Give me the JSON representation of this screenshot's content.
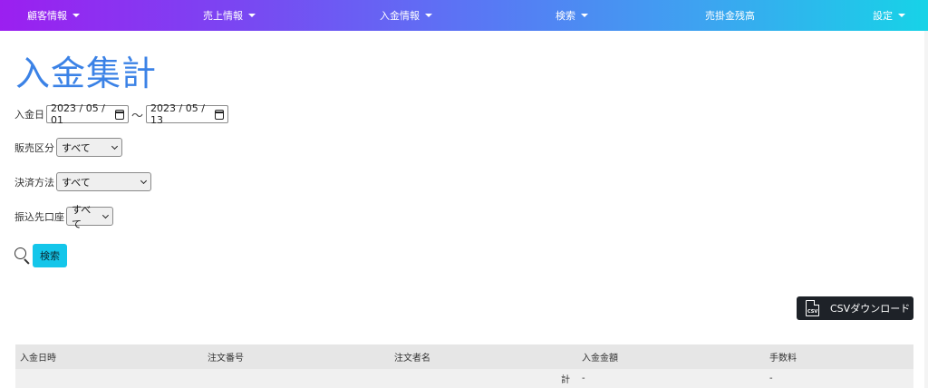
{
  "navbar": {
    "items": [
      {
        "label": "顧客情報",
        "dropdown": true
      },
      {
        "label": "売上情報",
        "dropdown": true
      },
      {
        "label": "入金情報",
        "dropdown": true
      },
      {
        "label": "検索",
        "dropdown": true
      },
      {
        "label": "売掛金残高",
        "dropdown": false
      },
      {
        "label": "設定",
        "dropdown": true
      }
    ]
  },
  "page": {
    "title": "入金集計"
  },
  "filters": {
    "payment_date_label": "入金日",
    "date_from": "2023 / 05 / 01",
    "date_separator": "〜",
    "date_to": "2023 / 05 / 13",
    "sales_category_label": "販売区分",
    "sales_category_value": "すべて",
    "payment_method_label": "決済方法",
    "payment_method_value": "すべて",
    "transfer_account_label": "振込先口座",
    "transfer_account_value": "すべて",
    "search_button": "検索"
  },
  "csv": {
    "button_label": "CSVダウンロード",
    "icon_text": "CSV"
  },
  "table": {
    "headers": [
      "入金日時",
      "注文番号",
      "注文者名",
      "入金金額",
      "手数料"
    ],
    "total_row": {
      "label": "計",
      "amount": "-",
      "fee": "-"
    }
  },
  "colors": {
    "nav_gradient_start": "#9b1ff0",
    "nav_gradient_end": "#17d3e7",
    "title": "#3b82e6",
    "search_button": "#14c6ea",
    "csv_button": "#1e2228",
    "table_header": "#e6e6e6"
  }
}
